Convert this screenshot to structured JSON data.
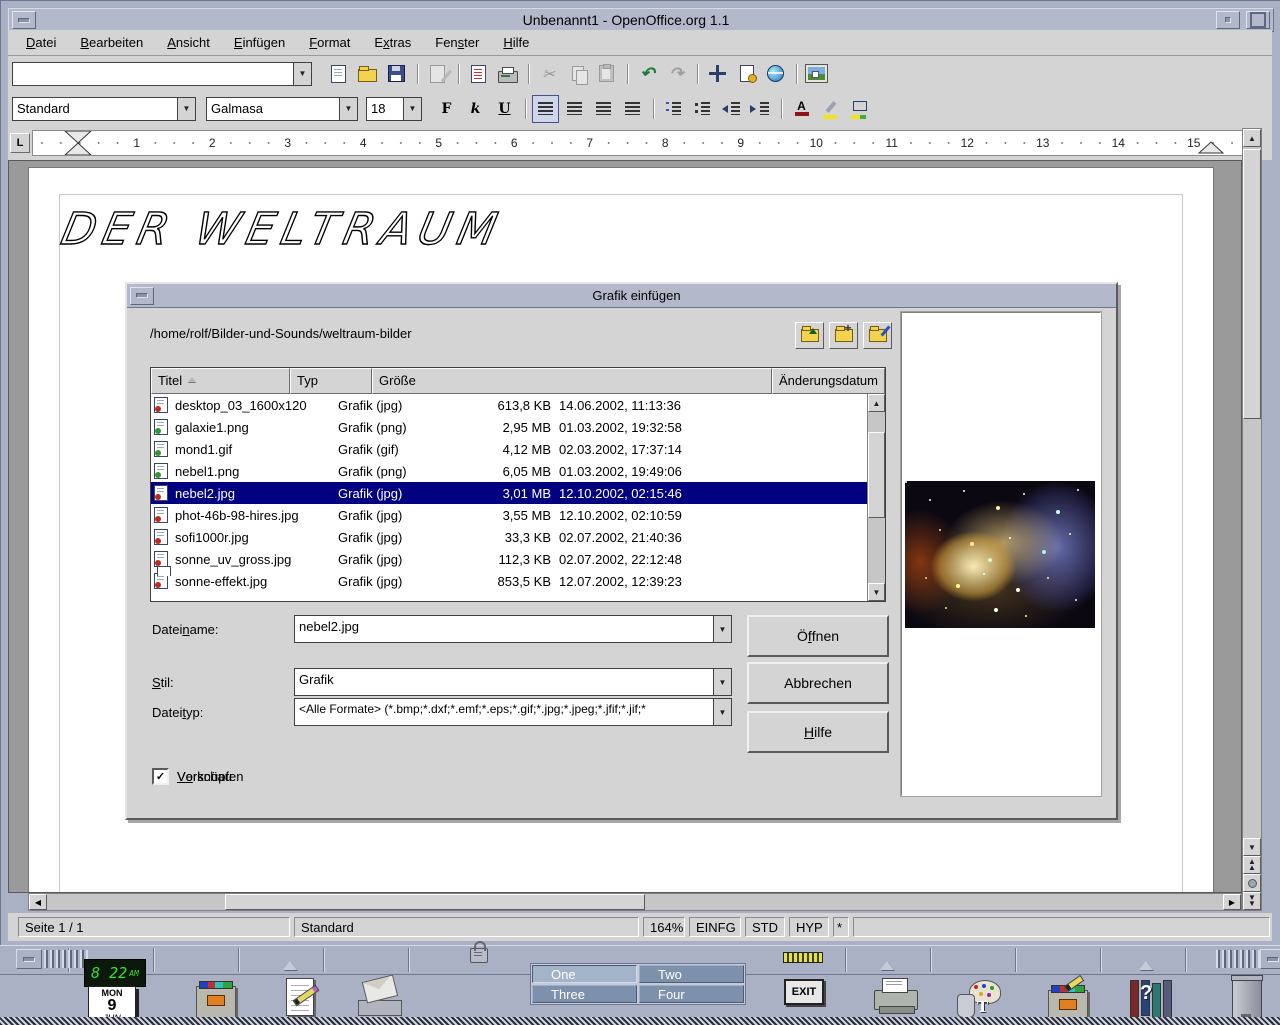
{
  "window": {
    "title": "Unbenannt1 - OpenOffice.org 1.1"
  },
  "menu": {
    "items": [
      {
        "pre": "",
        "accel": "D",
        "post": "atei"
      },
      {
        "pre": "",
        "accel": "B",
        "post": "earbeiten"
      },
      {
        "pre": "",
        "accel": "A",
        "post": "nsicht"
      },
      {
        "pre": "",
        "accel": "E",
        "post": "infügen"
      },
      {
        "pre": "",
        "accel": "F",
        "post": "ormat"
      },
      {
        "pre": "E",
        "accel": "x",
        "post": "tras"
      },
      {
        "pre": "Fen",
        "accel": "s",
        "post": "ter"
      },
      {
        "pre": "",
        "accel": "H",
        "post": "ilfe"
      }
    ]
  },
  "toolbar": {
    "url_value": "",
    "icons": [
      {
        "icon": "new-doc"
      },
      {
        "icon": "open-folder"
      },
      {
        "icon": "save"
      },
      {
        "icon": "sep"
      },
      {
        "icon": "edit-file",
        "disabled": true
      },
      {
        "icon": "sep"
      },
      {
        "icon": "pdf"
      },
      {
        "icon": "print"
      },
      {
        "icon": "sep"
      },
      {
        "icon": "cut",
        "disabled": true
      },
      {
        "icon": "copy",
        "disabled": true
      },
      {
        "icon": "paste",
        "disabled": true
      },
      {
        "icon": "sep"
      },
      {
        "icon": "undo"
      },
      {
        "icon": "redo",
        "disabled": true
      },
      {
        "icon": "sep"
      },
      {
        "icon": "navigator"
      },
      {
        "icon": "stylist"
      },
      {
        "icon": "hyperlink"
      },
      {
        "icon": "sep"
      },
      {
        "icon": "gallery"
      }
    ]
  },
  "format": {
    "style_value": "Standard",
    "font_value": "Galmasa",
    "size_value": "18",
    "icons": [
      {
        "icon": "bold",
        "glyph": "F"
      },
      {
        "icon": "italic",
        "glyph": "k"
      },
      {
        "icon": "underline",
        "glyph": "U"
      },
      {
        "icon": "sep"
      },
      {
        "icon": "align-left",
        "active": true
      },
      {
        "icon": "align-center"
      },
      {
        "icon": "align-right"
      },
      {
        "icon": "align-justify"
      },
      {
        "icon": "sep"
      },
      {
        "icon": "numbered-list"
      },
      {
        "icon": "bullet-list"
      },
      {
        "icon": "indent-decrease"
      },
      {
        "icon": "indent-increase"
      },
      {
        "icon": "sep"
      },
      {
        "icon": "font-color",
        "glyph": "A"
      },
      {
        "icon": "highlight"
      },
      {
        "icon": "paragraph-bg"
      }
    ]
  },
  "ruler": {
    "numbers": [
      {
        "n": "1"
      },
      {
        "n": "2"
      },
      {
        "n": "3"
      },
      {
        "n": "4"
      },
      {
        "n": "5"
      },
      {
        "n": "6"
      },
      {
        "n": "7"
      },
      {
        "n": "8"
      },
      {
        "n": "9"
      },
      {
        "n": "10"
      },
      {
        "n": "11"
      },
      {
        "n": "12"
      },
      {
        "n": "13"
      },
      {
        "n": "14"
      },
      {
        "n": "15"
      }
    ]
  },
  "document": {
    "heading": "DER WELTRAUM"
  },
  "dialog": {
    "title": "Grafik einfügen",
    "path": "/home/rolf/Bilder-und-Sounds/weltraum-bilder",
    "table": {
      "headers": [
        {
          "label": "Titel",
          "sort": true
        },
        {
          "label": "Typ"
        },
        {
          "label": "Größe"
        },
        {
          "label": "Änderungsdatum"
        }
      ],
      "rows": [
        {
          "name": "desktop_03_1600x120",
          "type": "Grafik (jpg)",
          "size": "613,8 KB",
          "date": "14.06.2002, 11:13:36",
          "icon": "jpg"
        },
        {
          "name": "galaxie1.png",
          "type": "Grafik (png)",
          "size": "2,95 MB",
          "date": "01.03.2002, 19:32:58",
          "icon": "png"
        },
        {
          "name": "mond1.gif",
          "type": "Grafik (gif)",
          "size": "4,12 MB",
          "date": "02.03.2002, 17:37:14",
          "icon": "gif"
        },
        {
          "name": "nebel1.png",
          "type": "Grafik (png)",
          "size": "6,05 MB",
          "date": "01.03.2002, 19:49:06",
          "icon": "png"
        },
        {
          "name": "nebel2.jpg",
          "type": "Grafik (jpg)",
          "size": "3,01 MB",
          "date": "12.10.2002, 02:15:46",
          "icon": "jpg",
          "selected": true
        },
        {
          "name": "phot-46b-98-hires.jpg",
          "type": "Grafik (jpg)",
          "size": "3,55 MB",
          "date": "12.10.2002, 02:10:59",
          "icon": "jpg"
        },
        {
          "name": "sofi1000r.jpg",
          "type": "Grafik (jpg)",
          "size": "33,3 KB",
          "date": "02.07.2002, 21:40:36",
          "icon": "jpg"
        },
        {
          "name": "sonne_uv_gross.jpg",
          "type": "Grafik (jpg)",
          "size": "112,3 KB",
          "date": "02.07.2002, 22:12:48",
          "icon": "jpg"
        },
        {
          "name": "sonne-effekt.jpg",
          "type": "Grafik (jpg)",
          "size": "853,5 KB",
          "date": "12.07.2002, 12:39:23",
          "icon": "jpg"
        }
      ]
    },
    "fields": {
      "filename_label": {
        "pre": "Datei",
        "accel": "n",
        "post": "ame:"
      },
      "filename_value": "nebel2.jpg",
      "style_label": {
        "pre": "",
        "accel": "S",
        "post": "til:"
      },
      "style_value": "Grafik",
      "filetype_label": {
        "pre": "Datei",
        "accel": "t",
        "post": "yp:"
      },
      "filetype_value": "<Alle Formate> (*.bmp;*.dxf;*.emf;*.eps;*.gif;*.jpg;*.jpeg;*.jfif;*.jif;*"
    },
    "buttons": {
      "open": {
        "pre": "Ö",
        "accel": "f",
        "post": "fnen"
      },
      "cancel": {
        "pre": "Abbrechen",
        "accel": "",
        "post": ""
      },
      "help": {
        "pre": "",
        "accel": "H",
        "post": "ilfe"
      }
    },
    "checkboxes": [
      {
        "pre": "",
        "accel": "V",
        "post": "erknüpfen",
        "checked": false
      },
      {
        "pre": "V",
        "accel": "o",
        "post": "rschau",
        "checked": true
      }
    ]
  },
  "statusbar": {
    "page": "Seite 1 / 1",
    "style": "Standard",
    "zoom": "164%",
    "insert_mode": "EINFG",
    "selection_mode": "STD",
    "hyperlink_mode": "HYP",
    "modified_flag": "*"
  },
  "panel": {
    "clock_time": "8 22",
    "clock_ampm": "AM",
    "cal_day": "MON",
    "cal_date": "9",
    "cal_month": "JUN",
    "workspaces": [
      {
        "label": "One",
        "active": true
      },
      {
        "label": "Two"
      },
      {
        "label": "Three"
      },
      {
        "label": "Four"
      }
    ],
    "exit_label": "EXIT"
  }
}
